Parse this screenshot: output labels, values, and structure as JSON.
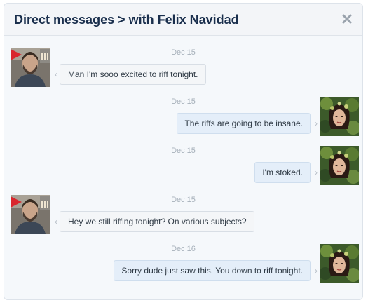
{
  "dialog": {
    "title": "Direct messages > with Felix Navidad",
    "close_icon": "close-icon"
  },
  "messages": [
    {
      "direction": "incoming",
      "date": "Dec 15",
      "text": "Man I'm sooo excited to riff tonight.",
      "avatar": "avatar-felix"
    },
    {
      "direction": "outgoing",
      "date": "Dec 15",
      "text": "The riffs are going to be insane.",
      "avatar": "avatar-self"
    },
    {
      "direction": "outgoing",
      "date": "Dec 15",
      "text": "I'm stoked.",
      "avatar": "avatar-self"
    },
    {
      "direction": "incoming",
      "date": "Dec 15",
      "text": "Hey we still riffing tonight? On various subjects?",
      "avatar": "avatar-felix"
    },
    {
      "direction": "outgoing",
      "date": "Dec 16",
      "text": "Sorry dude just saw this. You down to riff tonight.",
      "avatar": "avatar-self"
    }
  ],
  "colors": {
    "title": "#1a2f4d",
    "outgoing_bubble": "#e4eef9",
    "incoming_bubble": "#f4f6f8",
    "date": "#a6b0ba"
  }
}
